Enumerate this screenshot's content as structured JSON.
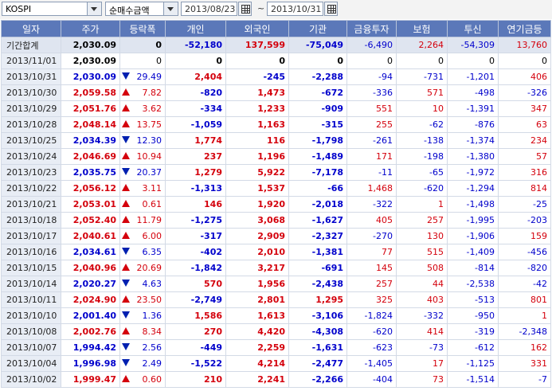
{
  "toolbar": {
    "market": "KOSPI",
    "metric": "순매수금액",
    "start_date": "2013/08/23",
    "separator": "~",
    "end_date": "2013/10/31"
  },
  "columns": [
    "일자",
    "주가",
    "등락폭",
    "개인",
    "외국인",
    "기관",
    "금융투자",
    "보험",
    "투신",
    "연기금등"
  ],
  "total": {
    "label": "기간합계",
    "price": "2,030.09",
    "change": "0",
    "individual": "-52,180",
    "foreign": "137,599",
    "institution": "-75,049",
    "fin_invest": "-6,490",
    "insurance": "2,264",
    "trust": "-54,309",
    "pension": "13,760"
  },
  "rows": [
    {
      "date": "2013/11/01",
      "price": "2,030.09",
      "dir": "none",
      "change": "0",
      "individual": "0",
      "foreign": "0",
      "institution": "0",
      "fin_invest": "0",
      "insurance": "0",
      "trust": "0",
      "pension": "0"
    },
    {
      "date": "2013/10/31",
      "price": "2,030.09",
      "dir": "down",
      "change": "29.49",
      "individual": "2,404",
      "foreign": "-245",
      "institution": "-2,288",
      "fin_invest": "-94",
      "insurance": "-731",
      "trust": "-1,201",
      "pension": "406"
    },
    {
      "date": "2013/10/30",
      "price": "2,059.58",
      "dir": "up",
      "change": "7.82",
      "individual": "-820",
      "foreign": "1,473",
      "institution": "-672",
      "fin_invest": "-336",
      "insurance": "571",
      "trust": "-498",
      "pension": "-326"
    },
    {
      "date": "2013/10/29",
      "price": "2,051.76",
      "dir": "up",
      "change": "3.62",
      "individual": "-334",
      "foreign": "1,233",
      "institution": "-909",
      "fin_invest": "551",
      "insurance": "10",
      "trust": "-1,391",
      "pension": "347"
    },
    {
      "date": "2013/10/28",
      "price": "2,048.14",
      "dir": "up",
      "change": "13.75",
      "individual": "-1,059",
      "foreign": "1,163",
      "institution": "-315",
      "fin_invest": "255",
      "insurance": "-62",
      "trust": "-876",
      "pension": "63"
    },
    {
      "date": "2013/10/25",
      "price": "2,034.39",
      "dir": "down",
      "change": "12.30",
      "individual": "1,774",
      "foreign": "116",
      "institution": "-1,798",
      "fin_invest": "-261",
      "insurance": "-138",
      "trust": "-1,374",
      "pension": "234"
    },
    {
      "date": "2013/10/24",
      "price": "2,046.69",
      "dir": "up",
      "change": "10.94",
      "individual": "237",
      "foreign": "1,196",
      "institution": "-1,489",
      "fin_invest": "171",
      "insurance": "-198",
      "trust": "-1,380",
      "pension": "57"
    },
    {
      "date": "2013/10/23",
      "price": "2,035.75",
      "dir": "down",
      "change": "20.37",
      "individual": "1,279",
      "foreign": "5,922",
      "institution": "-7,178",
      "fin_invest": "-11",
      "insurance": "-65",
      "trust": "-1,972",
      "pension": "316"
    },
    {
      "date": "2013/10/22",
      "price": "2,056.12",
      "dir": "up",
      "change": "3.11",
      "individual": "-1,313",
      "foreign": "1,537",
      "institution": "-66",
      "fin_invest": "1,468",
      "insurance": "-620",
      "trust": "-1,294",
      "pension": "814"
    },
    {
      "date": "2013/10/21",
      "price": "2,053.01",
      "dir": "up",
      "change": "0.61",
      "individual": "146",
      "foreign": "1,920",
      "institution": "-2,018",
      "fin_invest": "-322",
      "insurance": "1",
      "trust": "-1,498",
      "pension": "-25"
    },
    {
      "date": "2013/10/18",
      "price": "2,052.40",
      "dir": "up",
      "change": "11.79",
      "individual": "-1,275",
      "foreign": "3,068",
      "institution": "-1,627",
      "fin_invest": "405",
      "insurance": "257",
      "trust": "-1,995",
      "pension": "-203"
    },
    {
      "date": "2013/10/17",
      "price": "2,040.61",
      "dir": "up",
      "change": "6.00",
      "individual": "-317",
      "foreign": "2,909",
      "institution": "-2,327",
      "fin_invest": "-270",
      "insurance": "130",
      "trust": "-1,906",
      "pension": "159"
    },
    {
      "date": "2013/10/16",
      "price": "2,034.61",
      "dir": "down",
      "change": "6.35",
      "individual": "-402",
      "foreign": "2,010",
      "institution": "-1,381",
      "fin_invest": "77",
      "insurance": "515",
      "trust": "-1,409",
      "pension": "-456"
    },
    {
      "date": "2013/10/15",
      "price": "2,040.96",
      "dir": "up",
      "change": "20.69",
      "individual": "-1,842",
      "foreign": "3,217",
      "institution": "-691",
      "fin_invest": "145",
      "insurance": "508",
      "trust": "-814",
      "pension": "-820"
    },
    {
      "date": "2013/10/14",
      "price": "2,020.27",
      "dir": "down",
      "change": "4.63",
      "individual": "570",
      "foreign": "1,956",
      "institution": "-2,438",
      "fin_invest": "257",
      "insurance": "44",
      "trust": "-2,538",
      "pension": "-42"
    },
    {
      "date": "2013/10/11",
      "price": "2,024.90",
      "dir": "up",
      "change": "23.50",
      "individual": "-2,749",
      "foreign": "2,801",
      "institution": "1,295",
      "fin_invest": "325",
      "insurance": "403",
      "trust": "-513",
      "pension": "801"
    },
    {
      "date": "2013/10/10",
      "price": "2,001.40",
      "dir": "down",
      "change": "1.36",
      "individual": "1,586",
      "foreign": "1,613",
      "institution": "-3,106",
      "fin_invest": "-1,824",
      "insurance": "-332",
      "trust": "-950",
      "pension": "1"
    },
    {
      "date": "2013/10/08",
      "price": "2,002.76",
      "dir": "up",
      "change": "8.34",
      "individual": "270",
      "foreign": "4,420",
      "institution": "-4,308",
      "fin_invest": "-620",
      "insurance": "414",
      "trust": "-319",
      "pension": "-2,348"
    },
    {
      "date": "2013/10/07",
      "price": "1,994.42",
      "dir": "down",
      "change": "2.56",
      "individual": "-449",
      "foreign": "2,259",
      "institution": "-1,631",
      "fin_invest": "-623",
      "insurance": "-73",
      "trust": "-612",
      "pension": "162"
    },
    {
      "date": "2013/10/04",
      "price": "1,996.98",
      "dir": "down",
      "change": "2.49",
      "individual": "-1,522",
      "foreign": "4,214",
      "institution": "-2,477",
      "fin_invest": "-1,405",
      "insurance": "17",
      "trust": "-1,125",
      "pension": "331"
    },
    {
      "date": "2013/10/02",
      "price": "1,999.47",
      "dir": "up",
      "change": "0.60",
      "individual": "210",
      "foreign": "2,241",
      "institution": "-2,266",
      "fin_invest": "-404",
      "insurance": "73",
      "trust": "-1,514",
      "pension": "-7"
    }
  ],
  "colors": {
    "up": "#d4000c",
    "down": "#0000cc",
    "header_bg": "#5b78b9"
  }
}
